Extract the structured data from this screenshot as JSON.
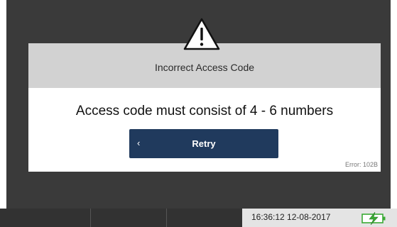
{
  "dialog": {
    "title": "Incorrect Access Code",
    "message": "Access code must consist of 4 - 6 numbers",
    "retry_label": "Retry",
    "retry_chevron": "‹",
    "error_code": "Error: 102B",
    "icon": "warning-icon"
  },
  "status": {
    "time": "16:36:12",
    "date": "12-08-2017",
    "datetime": "16:36:12  12-08-2017",
    "battery_icon": "battery-charging-icon",
    "battery_color": "#3aaa35"
  },
  "colors": {
    "bezel": "#3a3a3a",
    "dialog_header": "#d2d2d2",
    "button": "#203a5d"
  }
}
